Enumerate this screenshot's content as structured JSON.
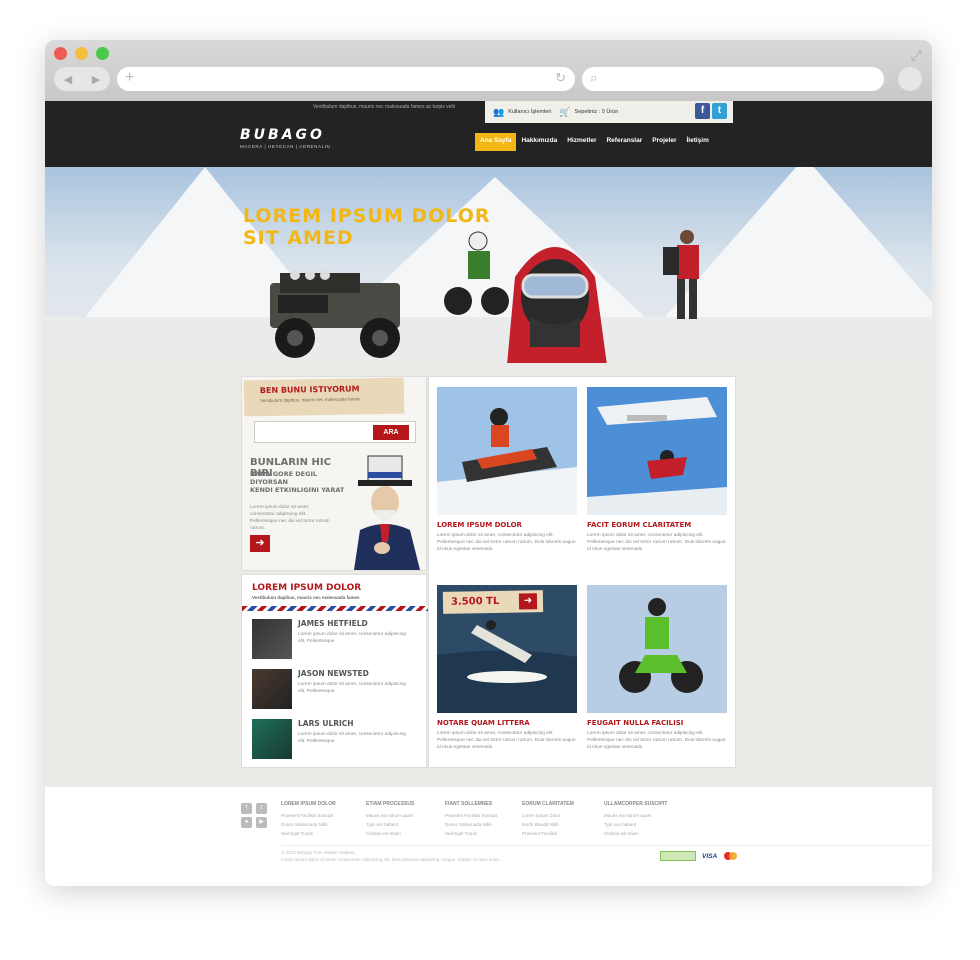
{
  "header": {
    "tagline": "Vestibulum dapibus, mauris nec malesuada fames ac turpis velit",
    "user_login": "Kullanıcı İşlemleri",
    "cart": "Sepetiniz : 0 Ürün",
    "logo": "BUBAGO",
    "logo_sub": "MACERA | HEYECAN | ADRENALIN",
    "nav": [
      "Ana Sayfa",
      "Hakkımızda",
      "Hizmetler",
      "Referanslar",
      "Projeler",
      "İletişim"
    ]
  },
  "hero": {
    "title_line1": "LOREM IPSUM DOLOR",
    "title_line2": "SIT AMED"
  },
  "wish_box": {
    "title": "BEN BUNU ISTIYORUM",
    "subtitle": "Vestibulum dapibus, mauris nec malesuada fames",
    "search_button": "ARA",
    "headline": "BUNLARIN HIC BIRI",
    "subline1": "BANA GORE DEGIL DIYORSAN",
    "subline2": "KENDI ETKINLIGINI YARAT",
    "body": "Lorem ipsum dolor sit amet, consectetur adipiscing elit. Pellentesque nec dui vel tortor rutrum rutrum."
  },
  "team": {
    "title": "LOREM IPSUM DOLOR",
    "subtitle": "Vestibulum dapibus, mauris nec malesuada fames",
    "members": [
      {
        "name": "JAMES HETFIELD",
        "text": "Lorem ipsum dolor sit amet, consectetur adipiscing elit. Pellentesque"
      },
      {
        "name": "JASON NEWSTED",
        "text": "Lorem ipsum dolor sit amet, consectetur adipiscing elit. Pellentesque"
      },
      {
        "name": "LARS ULRICH",
        "text": "Lorem ipsum dolor sit amet, consectetur adipiscing elit. Pellentesque"
      }
    ]
  },
  "cards": [
    {
      "title": "LOREM IPSUM DOLOR",
      "text": "Lorem ipsum dolor sit amet, consectetur adipiscing elit. Pellentesque nec dui vel tortor rutrum rutrum. Duis lobortis augue id risus egestas venenatis."
    },
    {
      "title": "FACIT EORUM CLARITATEM",
      "text": "Lorem ipsum dolor sit amet, consectetur adipiscing elit. Pellentesque nec dui vel tortor rutrum rutrum. Duis lobortis augue id risus egestas venenatis."
    },
    {
      "title": "NOTARE QUAM LITTERA",
      "text": "Lorem ipsum dolor sit amet, consectetur adipiscing elit. Pellentesque nec dui vel tortor rutrum rutrum. Duis lobortis augue id risus egestas venenatis.",
      "price": "3.500 TL"
    },
    {
      "title": "FEUGAIT NULLA FACILISI",
      "text": "Lorem ipsum dolor sit amet, consectetur adipiscing elit. Pellentesque nec dui vel tortor rutrum rutrum. Duis lobortis augue id risus egestas venenatis."
    }
  ],
  "footer": {
    "columns": [
      {
        "heading": "LOREM IPSUM DOLOR",
        "items": [
          "Praesent Facilisis Suscipit",
          "Donec Malesuada Nibh",
          "Sed Eget Turpis"
        ]
      },
      {
        "heading": "ETIAM PROCESSUS",
        "items": [
          "Mauris est rutrum quam",
          "Typi non habent",
          "Claritas est etiam"
        ]
      },
      {
        "heading": "FIANT SOLLEMNES",
        "items": [
          "Praesent Facilisis Suscipit",
          "Donec Malesuada Nibh",
          "Sed Eget Turpis"
        ]
      },
      {
        "heading": "EORUM CLARITATEM",
        "items": [
          "Lorem Ipsum Dolor",
          "Morbi Blandit Nibh",
          "Praesent Facilisis"
        ]
      },
      {
        "heading": "ULLAMCORPER SUSCIPIT",
        "items": [
          "Mauris est rutrum quam",
          "Typi non habent",
          "Claritas est etiam"
        ]
      }
    ],
    "copyright": "© 2012 Bubago Tüm Hakları Saklıdır.",
    "copyright_sub": "Lorem ipsum dolor sit amet, consectetur adipiscing elit. Duis placerat adipiscing congue. Integer et risus enim.",
    "visa": "VISA"
  }
}
